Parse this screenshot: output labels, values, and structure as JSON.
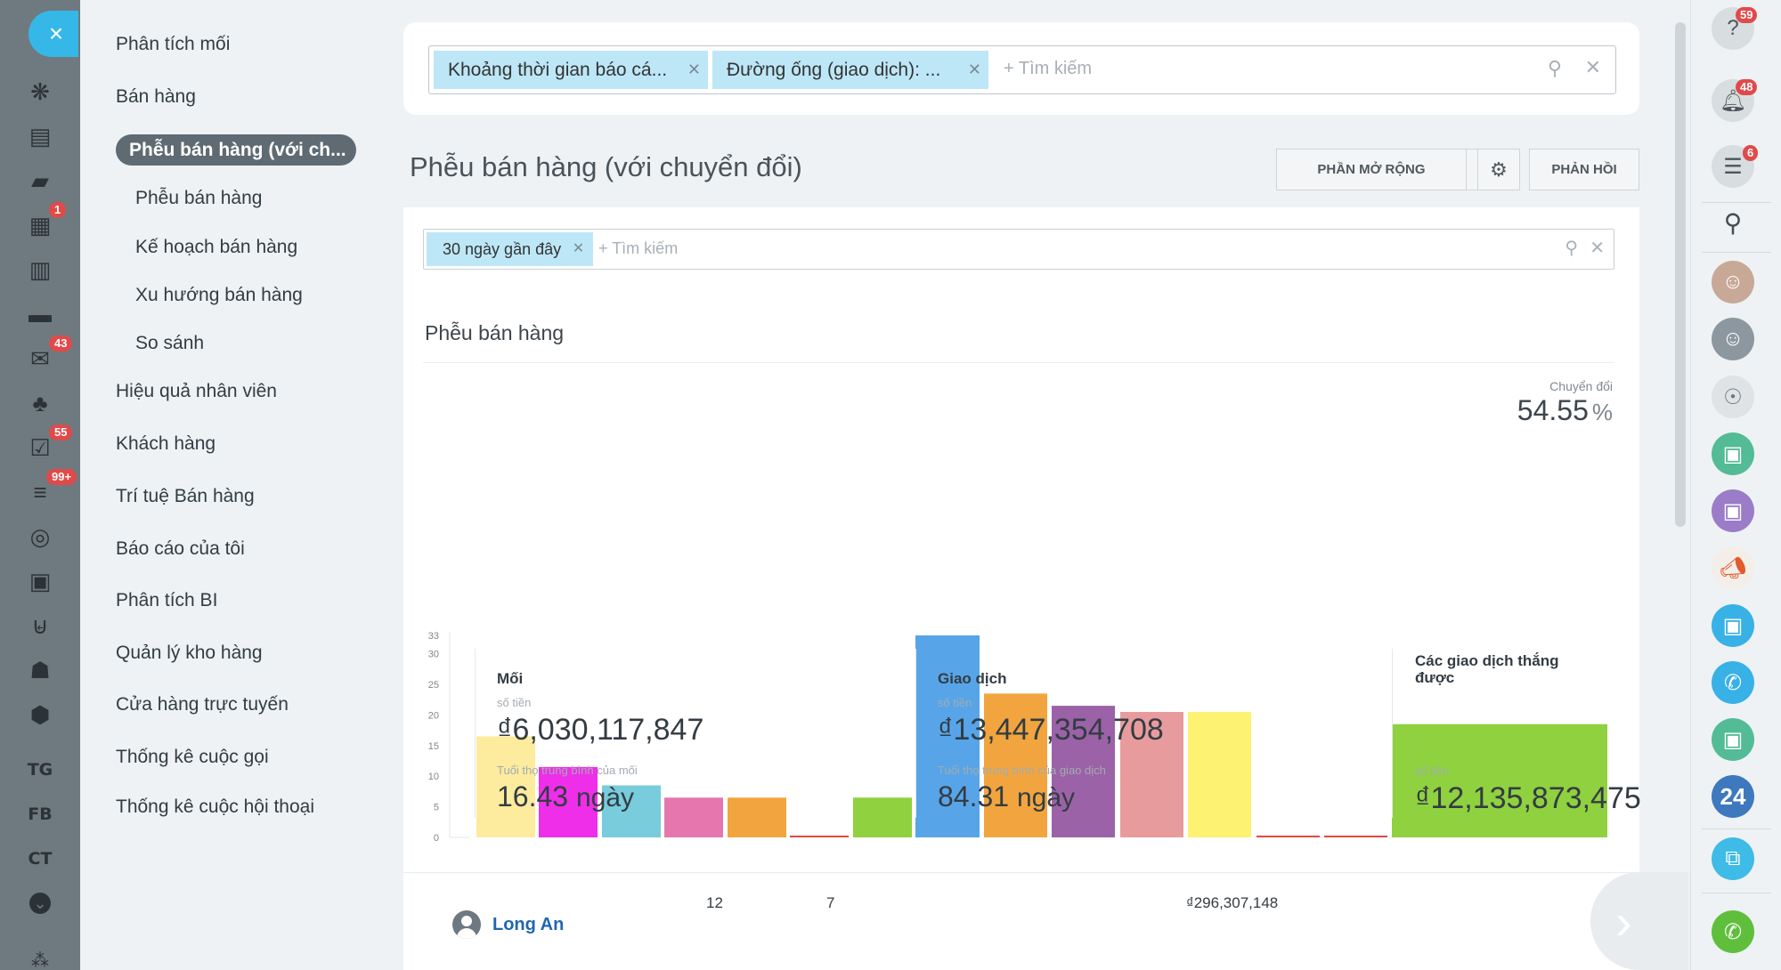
{
  "leftbar": {
    "close_icon": "×",
    "icons": [
      {
        "name": "analytics-icon",
        "glyph": "❋",
        "badge": null
      },
      {
        "name": "feed-icon",
        "glyph": "▤",
        "badge": null
      },
      {
        "name": "chat-icon",
        "glyph": "▰",
        "badge": null
      },
      {
        "name": "calendar-icon",
        "glyph": "▦",
        "badge": "1"
      },
      {
        "name": "document-icon",
        "glyph": "▥",
        "badge": null
      },
      {
        "name": "drive-icon",
        "glyph": "▬",
        "badge": null
      },
      {
        "name": "mail-icon",
        "glyph": "✉",
        "badge": "43"
      },
      {
        "name": "contacts-icon",
        "glyph": "♣",
        "badge": null
      },
      {
        "name": "tasks-icon",
        "glyph": "☑",
        "badge": "55"
      },
      {
        "name": "crm-funnel-icon",
        "glyph": "≡",
        "badge": "99+"
      },
      {
        "name": "target-icon",
        "glyph": "◎",
        "badge": null
      },
      {
        "name": "contact-card-icon",
        "glyph": "▣",
        "badge": null
      },
      {
        "name": "shop-cart-icon",
        "glyph": "⊌",
        "badge": null
      },
      {
        "name": "robot-icon",
        "glyph": "☗",
        "badge": null
      },
      {
        "name": "box-icon",
        "glyph": "⬢",
        "badge": null
      }
    ],
    "text_items": [
      "TG",
      "FB",
      "CT"
    ],
    "more_icon": "⌄",
    "bottom_icon": "⁂"
  },
  "menu": {
    "items": [
      {
        "label": "Phân tích mối",
        "sub": false
      },
      {
        "label": "Bán hàng",
        "sub": false
      },
      {
        "label": "Phễu bán hàng",
        "sub": true
      },
      {
        "label": "Kế hoạch bán hàng",
        "sub": true
      },
      {
        "label": "Xu hướng bán hàng",
        "sub": true
      },
      {
        "label": "So sánh",
        "sub": true
      },
      {
        "label": "Hiệu quả nhân viên",
        "sub": false
      },
      {
        "label": "Khách hàng",
        "sub": false
      },
      {
        "label": "Trí tuệ Bán hàng",
        "sub": false
      },
      {
        "label": "Báo cáo của tôi",
        "sub": false
      },
      {
        "label": "Phân tích BI",
        "sub": false
      },
      {
        "label": "Quản lý kho hàng",
        "sub": false
      },
      {
        "label": "Cửa hàng trực tuyến",
        "sub": false
      },
      {
        "label": "Thống kê cuộc gọi",
        "sub": false
      },
      {
        "label": "Thống kê cuộc hội thoại",
        "sub": false
      }
    ],
    "active_label": "Phễu bán hàng (với ch..."
  },
  "top_filter": {
    "chips": [
      "Khoảng thời gian báo cá...",
      "Đường ống (giao dịch): ..."
    ],
    "placeholder": "+ Tìm kiếm"
  },
  "page_title": "Phễu bán hàng (với chuyển đổi)",
  "toolbar": {
    "extensions_label": "PHẦN MỞ RỘNG",
    "feedback_label": "PHẢN HỒI"
  },
  "content_filter": {
    "chip": "30 ngày gần đây",
    "placeholder": "+ Tìm kiếm"
  },
  "section_title": "Phễu bán hàng",
  "conversion": {
    "label": "Chuyển đổi",
    "value": "54.55",
    "unit": "%"
  },
  "chart_data": {
    "type": "bar",
    "yticks": [
      0,
      5,
      10,
      15,
      20,
      25,
      30,
      33
    ],
    "ylim": [
      0,
      33
    ],
    "bars": [
      {
        "value": 16.5,
        "color": "#fdeb9e"
      },
      {
        "value": 11.5,
        "color": "#ee2ee8"
      },
      {
        "value": 8.5,
        "color": "#78ccdc"
      },
      {
        "value": 6.5,
        "color": "#e577ae"
      },
      {
        "value": 6.5,
        "color": "#f2a53e"
      },
      {
        "value": 0.3,
        "color": "#e04a44"
      },
      {
        "value": 6.5,
        "color": "#8fd13f"
      },
      {
        "value": 33,
        "color": "#57a5e8"
      },
      {
        "value": 23.5,
        "color": "#f2a53e"
      },
      {
        "value": 21.5,
        "color": "#9b62a7"
      },
      {
        "value": 20.5,
        "color": "#e89b9d"
      },
      {
        "value": 20.5,
        "color": "#fdf272"
      },
      {
        "value": 0.3,
        "color": "#e04a44"
      },
      {
        "value": 0.3,
        "color": "#e04a44"
      },
      {
        "value": 18.5,
        "color": "#8fd13f"
      }
    ]
  },
  "stats": {
    "leads": {
      "title": "Mối",
      "amount_label": "số tiền",
      "amount": "₫6,030,117,847",
      "age_label": "Tuổi thọ trung bình của mối",
      "age_value": "16.43",
      "age_unit": "ngày"
    },
    "deals": {
      "title": "Giao dịch",
      "amount_label": "số tiền",
      "amount": "₫13,447,354,708",
      "age_label": "Tuổi thọ trung bình của giao dịch",
      "age_value": "84.31",
      "age_unit": "ngày"
    },
    "won": {
      "title": "Các giao dịch thắng được",
      "amount_label": "số tiền",
      "amount": "₫12,135,873,475"
    }
  },
  "table_row": {
    "name": "Long An",
    "col1": "12",
    "col2": "7",
    "amount": "₫296,307,148"
  },
  "rightbar": {
    "help_badge": "59",
    "notify_badge": "48",
    "feed_badge": "6",
    "calendar24": "24"
  }
}
